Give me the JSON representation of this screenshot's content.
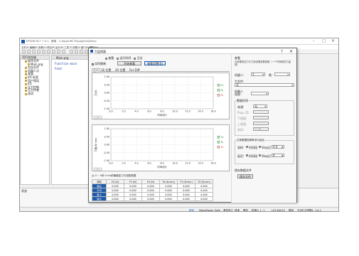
{
  "app": {
    "title": "EPSON RC+ 7.5.1 - 教導 - C:\\EpsonRC70\\projects\\Demo",
    "menu": [
      "文件(F)",
      "編輯(E)",
      "查看(V)",
      "项目(P)",
      "运行(R)",
      "工具(T)",
      "设置(S)",
      "窗口(W)",
      "帮助(H)"
    ],
    "tree_title": "项目浏览器",
    "tree_items": [
      "程序文件",
      "Main.prg",
      "包含文件",
      "机器人点",
      "变量",
      "I/O 标签",
      "用户错误",
      "I/O",
      "压力控制",
      "压力传感",
      "选项"
    ],
    "editor_tab": "Main.prg",
    "code_lines": [
      "Function main",
      "Fend"
    ],
    "status_panel_title": "状态",
    "statusbar": [
      "程序",
      "Motor",
      "Power",
      "Safe",
      "紧急停止",
      "错误",
      "警告",
      "机器人 1, 1",
      "LS3-B401S",
      "模拟",
      "无运行中任务",
      "行 1, Col 1"
    ]
  },
  "dialog": {
    "title": "力监视器",
    "close_glyph": "×",
    "mode_options": [
      "查看",
      "运行时间",
      "日志"
    ],
    "selected_mode": "查看",
    "check_label": "实时刷新",
    "start_button": "开始查看",
    "settings_button": "查看设置(S)",
    "tabs": [
      "压力",
      "16 位置",
      "20 位置",
      "For Diff"
    ],
    "plot1": {
      "ylabel": "力(N)",
      "xlabel": "时间(秒)",
      "legend": [
        "Fx",
        "Fy",
        "Fz"
      ]
    },
    "plot2": {
      "ylabel": "力矩(N·mm)",
      "xlabel": "时间(秒)",
      "legend": [
        "Tx",
        "Ty",
        "Tz"
      ]
    },
    "table_title": "从 0 ~ 0秒 0 ms的最值压力与扭矩数据",
    "table": {
      "columns": [
        "类型",
        "FX (N)",
        "FY (N)",
        "FZ (N)",
        "TX (N·mm)",
        "TY (N·mm)",
        "TZ (N·mm)"
      ],
      "rows": [
        [
          "最后",
          "0.000",
          "0.000",
          "0.000",
          "0.000",
          "0.000",
          "0.000"
        ],
        [
          "平均",
          "0.000",
          "0.000",
          "0.000",
          "0.000",
          "0.000",
          "0.000"
        ],
        [
          "最小",
          "0.000",
          "0.000",
          "0.000",
          "0.000",
          "0.000",
          "0.000"
        ],
        [
          "最大",
          "0.000",
          "0.000",
          "0.000",
          "0.000",
          "0.000",
          "0.000"
        ]
      ]
    },
    "side": {
      "heading": "查看",
      "help": "为收集的压力与力矩设置查看参数（一个时间段的力监视）",
      "robot_label": "机器人:",
      "robot_value": "1",
      "rank_label": "秩:",
      "rank_value": "",
      "force_file_label": "力文件:",
      "force_file_value": "无",
      "robot_local_label": "机器人\n局部：",
      "robot_local_value": "",
      "time_group": "数据时间",
      "source_label": "来源:",
      "source_value": "无",
      "rows": [
        {
          "label": "Prop. ID",
          "value": ""
        },
        {
          "label": "下限值:",
          "value": ""
        },
        {
          "label": "上限值:",
          "value": ""
        },
        {
          "label": "采样:",
          "value": "个 秒"
        }
      ],
      "record_group": "记录数据的频率(秒)/延迟",
      "sample_label": "采样:",
      "delay_label": "延迟:",
      "freq_label": "时间段",
      "stop_label": "Stop后",
      "sample_value": "0.0",
      "delay_value": "0",
      "save_group": "保存数据文件",
      "save_button": "保存文件"
    }
  },
  "chart_data": [
    {
      "type": "line",
      "title": "",
      "xlabel": "时间(秒)",
      "ylabel": "力(N)",
      "xlim": [
        0,
        16
      ],
      "ylim": [
        -1,
        1
      ],
      "x_ticks": [
        0.0,
        2.0,
        4.0,
        6.0,
        8.0,
        10.0,
        12.0,
        14.0,
        16.0
      ],
      "y_ticks": [
        1.0,
        0.5,
        0.0,
        -0.5,
        -1.0
      ],
      "grid": true,
      "legend": "right",
      "series": [
        {
          "name": "Fx",
          "x": [],
          "y": []
        },
        {
          "name": "Fy",
          "x": [],
          "y": []
        },
        {
          "name": "Fz",
          "x": [],
          "y": []
        }
      ]
    },
    {
      "type": "line",
      "title": "",
      "xlabel": "时间(秒)",
      "ylabel": "力矩(N·mm)",
      "xlim": [
        0,
        16
      ],
      "ylim": [
        -1,
        1
      ],
      "x_ticks": [
        0.0,
        2.0,
        4.0,
        6.0,
        8.0,
        10.0,
        12.0,
        14.0,
        16.0
      ],
      "y_ticks": [
        1.0,
        0.5,
        0.0,
        -0.5,
        -1.0
      ],
      "grid": true,
      "legend": "right",
      "series": [
        {
          "name": "Tx",
          "x": [],
          "y": []
        },
        {
          "name": "Ty",
          "x": [],
          "y": []
        },
        {
          "name": "Tz",
          "x": [],
          "y": []
        }
      ]
    }
  ],
  "colors": {
    "accent": "#1a5fb4",
    "table_row_header": "#1f5aa8",
    "legend_green": "#2a7a2a",
    "legend_red": "#c03030"
  }
}
